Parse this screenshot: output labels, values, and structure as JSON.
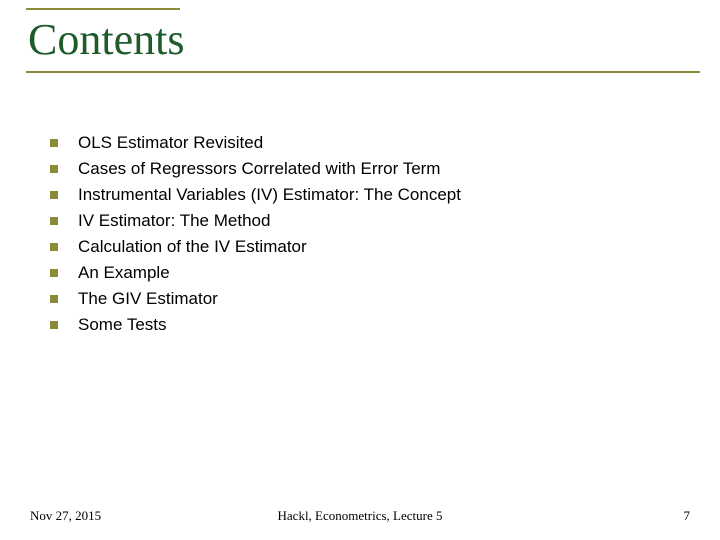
{
  "title": "Contents",
  "bullets": [
    "OLS Estimator Revisited",
    "Cases of Regressors Correlated with Error Term",
    "Instrumental Variables (IV) Estimator: The Concept",
    "IV Estimator: The Method",
    "Calculation of the IV Estimator",
    "An Example",
    "The GIV Estimator",
    "Some Tests"
  ],
  "footer": {
    "date": "Nov 27, 2015",
    "center": "Hackl,  Econometrics, Lecture 5",
    "page": "7"
  }
}
